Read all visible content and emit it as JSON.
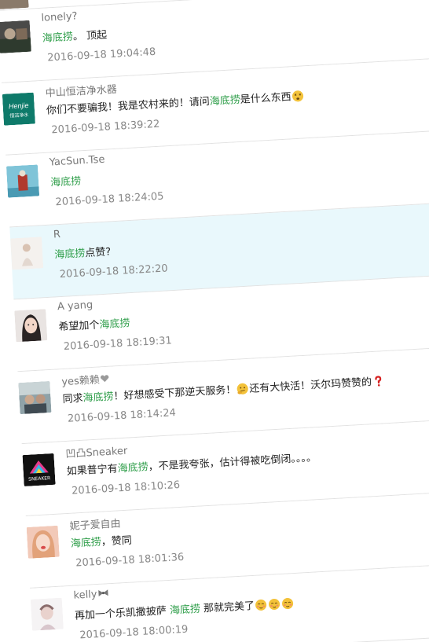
{
  "comments": [
    {
      "name": "lonely?",
      "text_parts": [
        "海底捞",
        "。 顶起"
      ],
      "time": "2016-09-18 19:04:48"
    },
    {
      "name": "中山恒洁净水器",
      "avatar_text": "Henjie",
      "avatar_sub": "恒洁净水",
      "text_parts": [
        "你们不要骗我！我是农村来的！请问",
        "海底捞",
        "是什么东西"
      ],
      "emoji": "dizzy-face-icon",
      "time": "2016-09-18 18:39:22"
    },
    {
      "name": "YacSun.Tse",
      "text_parts": [
        "海底捞"
      ],
      "time": "2016-09-18 18:24:05"
    },
    {
      "name": "R",
      "text_parts": [
        "海底捞",
        "点赞?"
      ],
      "time": "2016-09-18 18:22:20"
    },
    {
      "name": "A yang",
      "text_parts": [
        "希望加个",
        "海底捞"
      ],
      "time": "2016-09-18 18:19:31"
    },
    {
      "name": "yes赖赖",
      "name_icon": "heart-icon",
      "text_parts": [
        "同求",
        "海底捞",
        "！好想感受下那逆天服务！",
        "还有大快活！沃尔玛赞赞的"
      ],
      "emoji": [
        "thinking-face-icon",
        "red-question-mark-icon"
      ],
      "time": "2016-09-18 18:14:24"
    },
    {
      "name": "凹凸Sneaker",
      "avatar_text": "SNEAKER",
      "text_parts": [
        "如果普宁有",
        "海底捞",
        "，不是我夸张，估计得被吃倒闭。。。。"
      ],
      "time": "2016-09-18 18:10:26"
    },
    {
      "name": "妮子爱自由",
      "text_parts": [
        "海底捞",
        "，赞同"
      ],
      "time": "2016-09-18 18:01:36"
    },
    {
      "name": "kelly",
      "name_icon": "bow-icon",
      "text_parts": [
        "再加一个乐凯撒披萨 ",
        "海底捞",
        " 那就完美了"
      ],
      "emoji": [
        "blushing-face-icon",
        "blushing-face-icon",
        "blushing-face-icon"
      ],
      "time": "2016-09-18 18:00:19"
    }
  ],
  "colors": {
    "keyword": "#2f9e4a",
    "name": "#777777",
    "time": "#888888",
    "highlight_bg": "#e9f8fc"
  }
}
